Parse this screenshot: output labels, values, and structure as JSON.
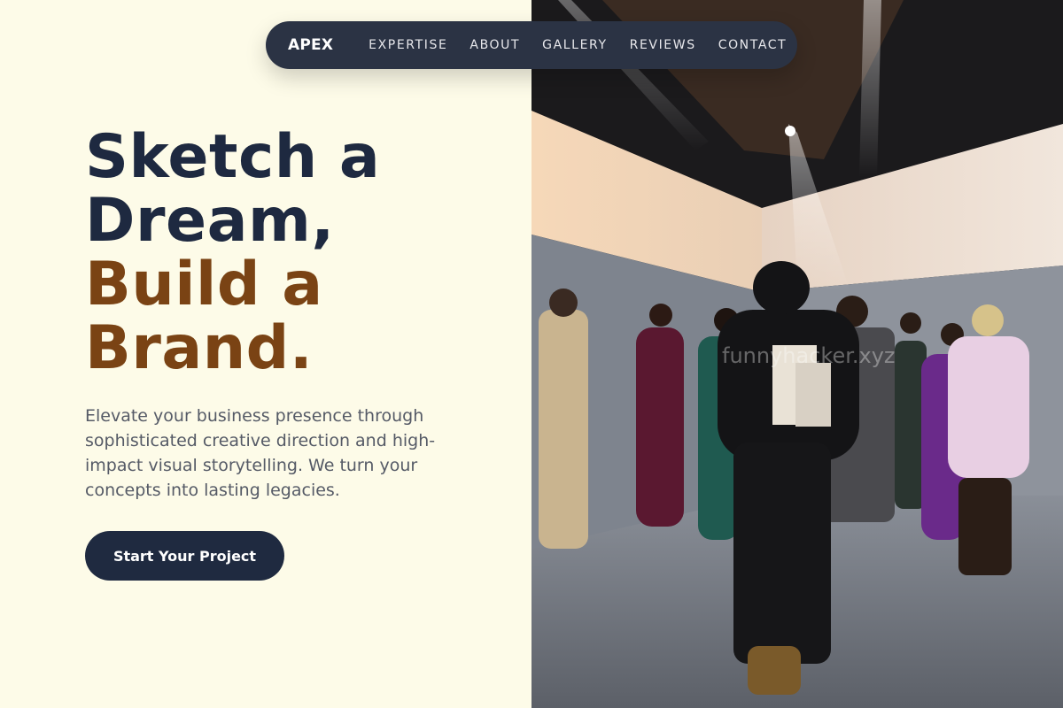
{
  "nav": {
    "brand": "APEX",
    "links": [
      "EXPERTISE",
      "ABOUT",
      "GALLERY",
      "REVIEWS",
      "CONTACT"
    ]
  },
  "hero": {
    "headline_lines": [
      "Sketch a",
      "Dream,",
      "Build a",
      "Brand."
    ],
    "subtext": "Elevate your business presence through sophisticated creative direction and high-impact visual storytelling. We turn your concepts into lasting legacies.",
    "cta_label": "Start Your Project"
  },
  "photo": {
    "description_icon": "fashion-show-photo",
    "watermark": "funnyhacker.xyz"
  },
  "colors": {
    "background": "#fdfbe8",
    "navbar": "#2b3344",
    "headline_dark": "#1e2940",
    "headline_accent": "#7a4314",
    "body_text": "#555a66",
    "cta": "#1f2a40"
  }
}
